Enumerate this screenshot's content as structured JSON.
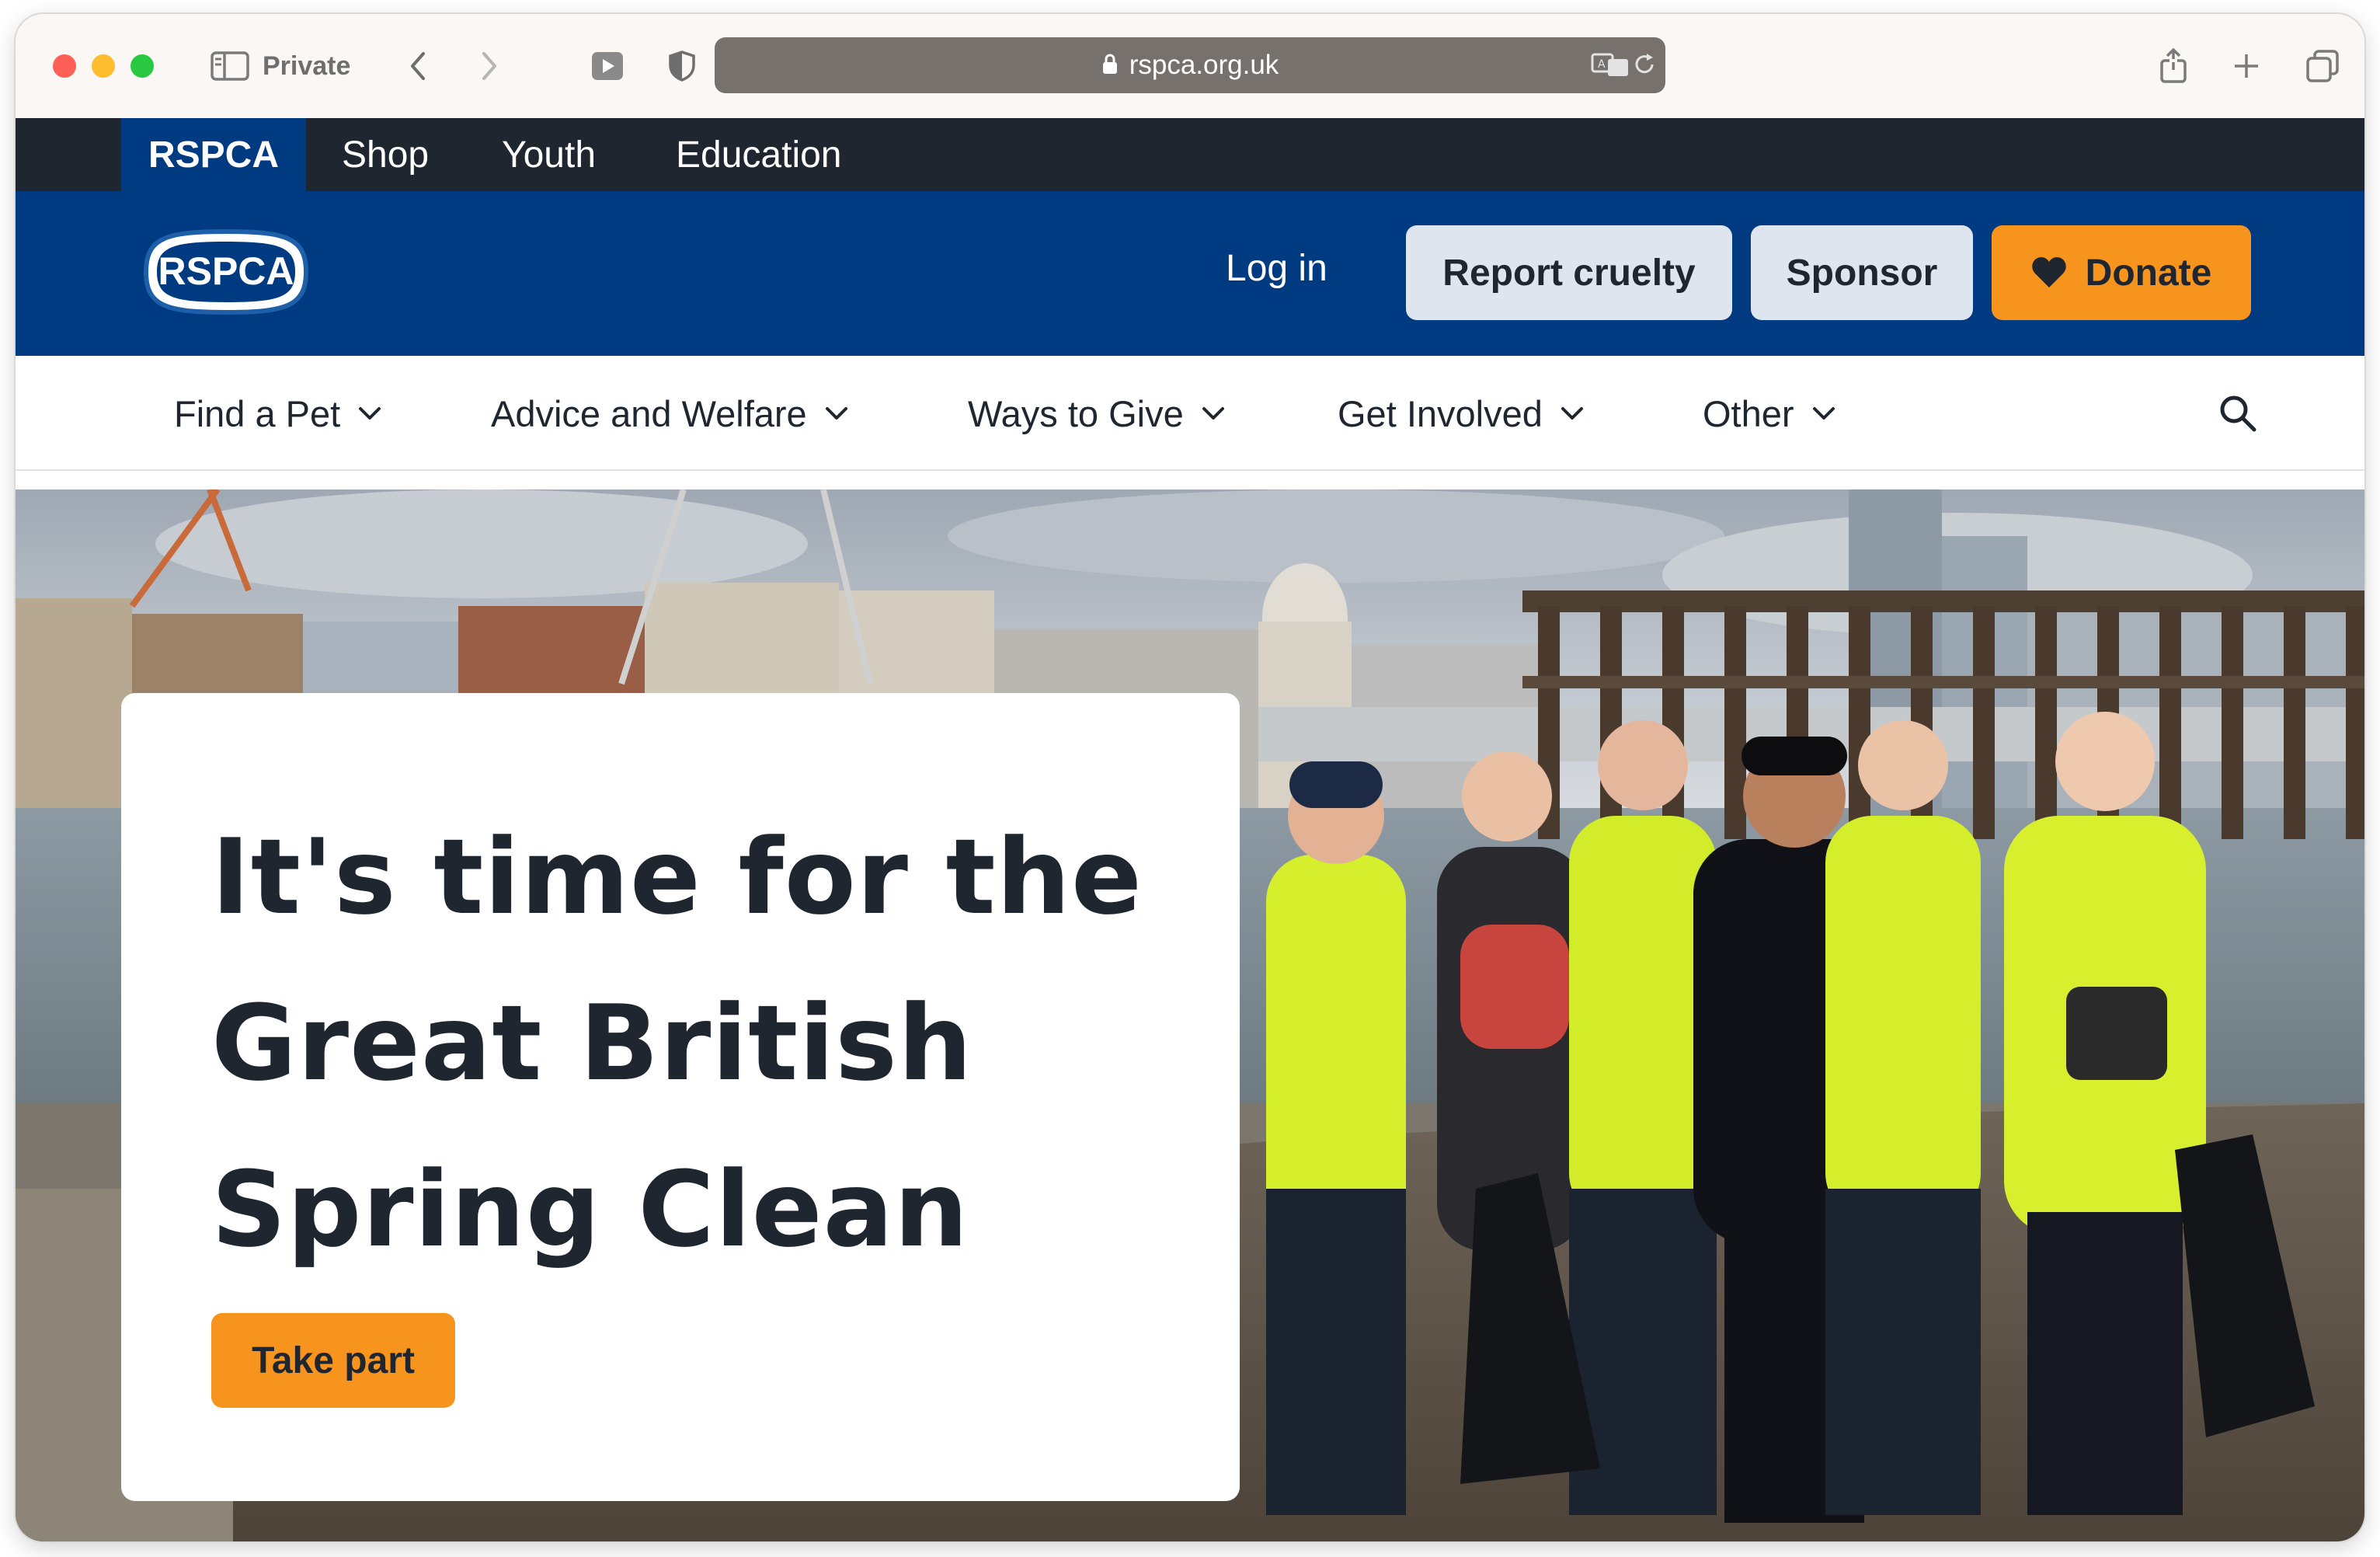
{
  "browser": {
    "private_label": "Private",
    "url": "rspca.org.uk",
    "icons": [
      "sidebar-icon",
      "back-icon",
      "forward-icon",
      "media-icon",
      "shield-icon",
      "lock-icon",
      "translate-icon",
      "reload-icon",
      "share-icon",
      "new-tab-icon",
      "tabs-overview-icon"
    ]
  },
  "utility_nav": {
    "items": [
      {
        "label": "RSPCA",
        "active": true
      },
      {
        "label": "Shop"
      },
      {
        "label": "Youth"
      },
      {
        "label": "Education"
      }
    ]
  },
  "header": {
    "logo_text": "RSPCA",
    "login_label": "Log in",
    "report_label": "Report cruelty",
    "sponsor_label": "Sponsor",
    "donate_label": "Donate"
  },
  "main_nav": {
    "items": [
      {
        "label": "Find a Pet"
      },
      {
        "label": "Advice and Welfare"
      },
      {
        "label": "Ways to Give"
      },
      {
        "label": "Get Involved"
      },
      {
        "label": "Other"
      }
    ],
    "search_icon": "search-icon"
  },
  "hero": {
    "title_lines": [
      "It's time for the",
      "Great British",
      "Spring Clean"
    ],
    "cta_label": "Take part"
  },
  "colors": {
    "brand_navy": "#003a80",
    "utility_dark": "#1f2630",
    "accent_orange": "#f7941d",
    "light_button": "#dfe5ee"
  }
}
